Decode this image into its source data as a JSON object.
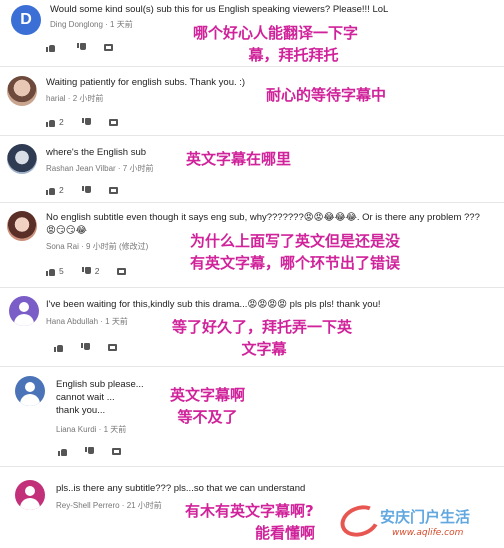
{
  "comments": [
    {
      "avatar_letter": "D",
      "text": "Would some kind soul(s) sub this for us English speaking viewers? Please!!! LoL",
      "author": "Ding Donglong",
      "time": "1 天前",
      "likes": "",
      "dislikes": "",
      "overlay_line1": "哪个好心人能翻译一下字",
      "overlay_line2": "幕，拜托拜托"
    },
    {
      "text": "Waiting patiently for english subs. Thank you. :)",
      "author": "harial",
      "time": "2 小时前",
      "likes": "2",
      "dislikes": "",
      "overlay_line1": "耐心的等待字幕中"
    },
    {
      "text": "where's the English sub",
      "author": "Rashan Jean Vilbar",
      "time": "7 小时前",
      "likes": "2",
      "dislikes": "",
      "overlay_line1": "英文字幕在哪里"
    },
    {
      "text_line1": "No english subtitle even though it says eng sub, why???????😡😡😂😂😂. Or is there any problem ???",
      "text_line2": "😡😏😏😂",
      "author": "Sona Rai",
      "time": "9 小时前",
      "edited": "(修改过)",
      "likes": "5",
      "dislikes": "2",
      "overlay_line1": "为什么上面写了英文但是还是没",
      "overlay_line2": "有英文字幕，哪个环节出了错误"
    },
    {
      "text": "I've been waiting for this,kindly sub this drama...😡😡😡😡 pls pls pls! thank you!",
      "author": "Hana Abdullah",
      "time": "1 天前",
      "likes": "",
      "dislikes": "",
      "overlay_line1": "等了好久了，拜托弄一下英",
      "overlay_line2": "文字幕"
    },
    {
      "text_line1": "English sub please...",
      "text_line2": "cannot wait ...",
      "text_line3": "thank you...",
      "author": "Liana Kurdi",
      "time": "1 天前",
      "likes": "",
      "dislikes": "",
      "overlay_line1": "英文字幕啊",
      "overlay_line2": "等不及了"
    },
    {
      "text": "pls..is there any subtitle??? pls...so that we can understand",
      "author": "Rey-Shell Perrero",
      "time": "21 小时前",
      "likes": "",
      "dislikes": "",
      "overlay_line1": "有木有英文字幕啊?",
      "overlay_line2": "能看懂啊"
    }
  ],
  "watermark": {
    "name": "安庆门户生活",
    "url": "www.aqlife.com"
  }
}
